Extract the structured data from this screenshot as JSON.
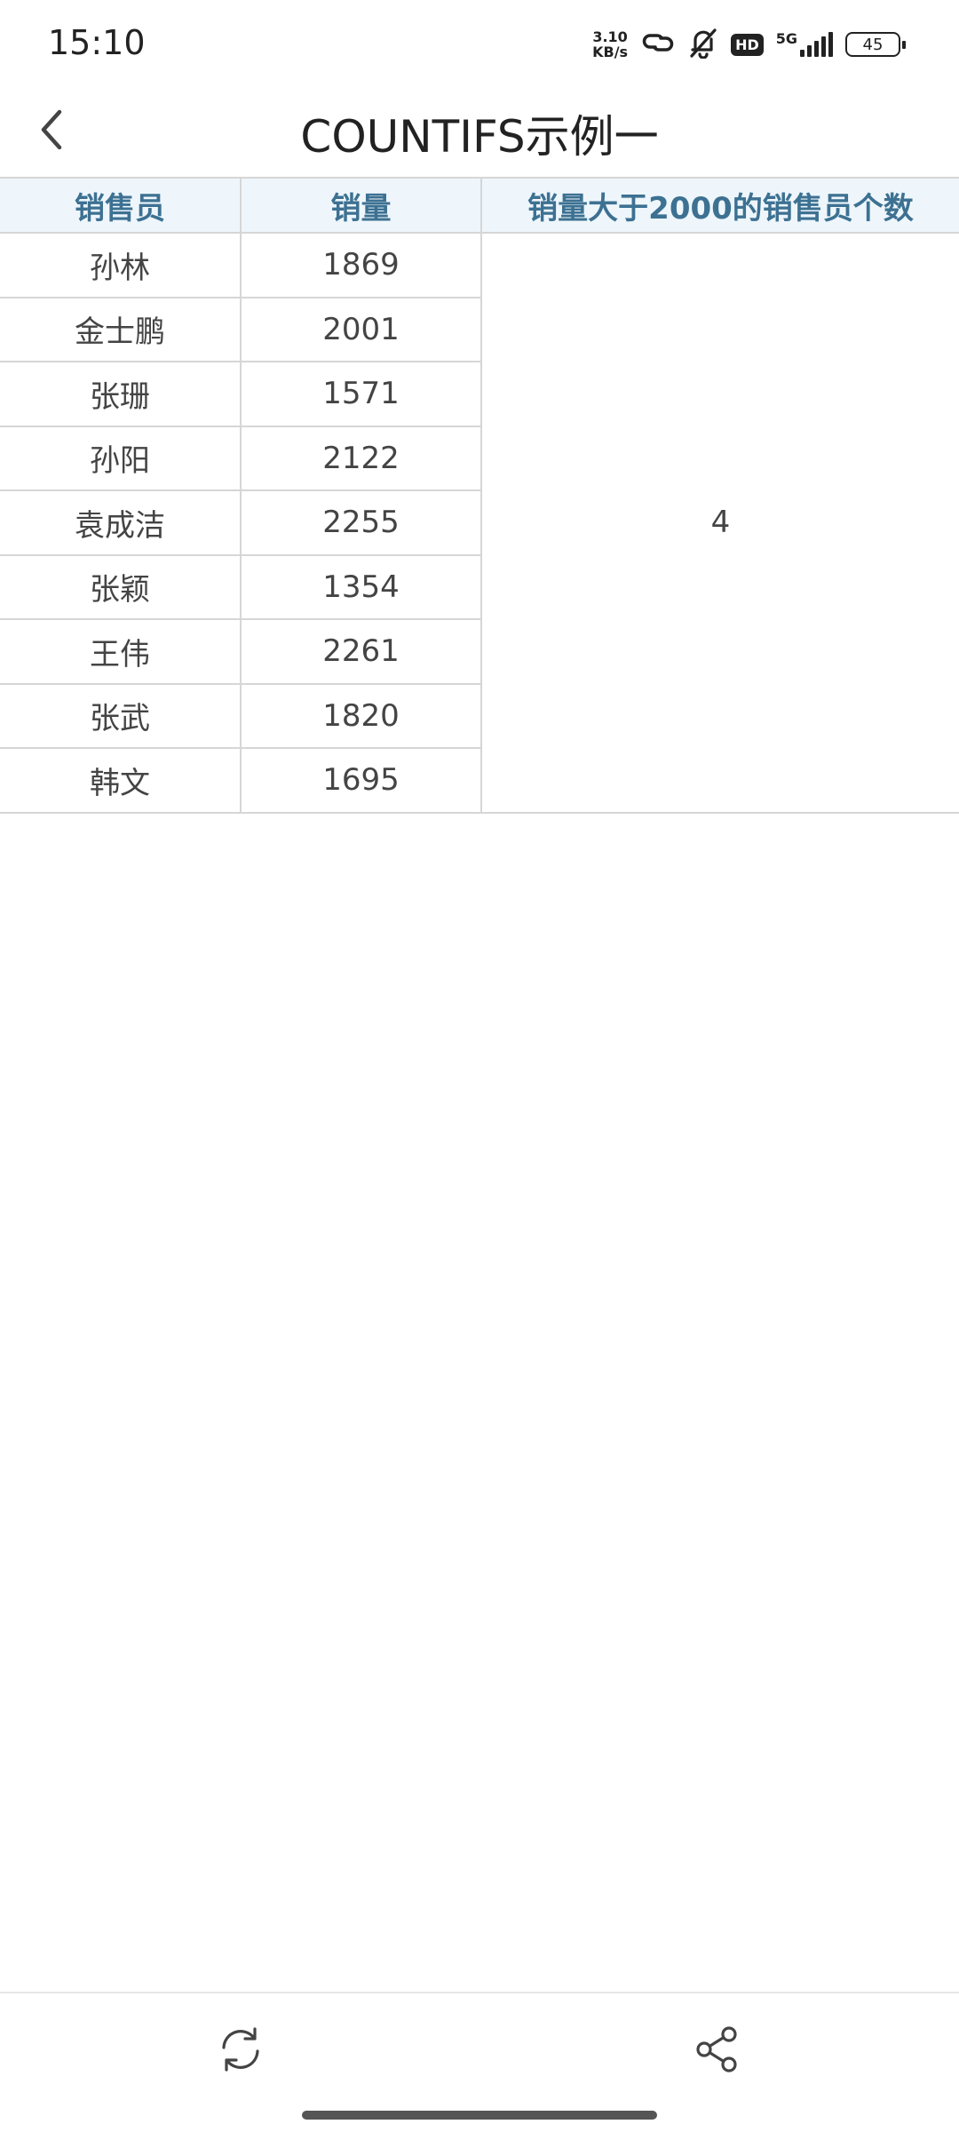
{
  "status_bar": {
    "time": "15:10",
    "net_speed_value": "3.10",
    "net_speed_unit": "KB/s",
    "hd": "HD",
    "network": "5G",
    "battery": "45",
    "icons": [
      "link-icon",
      "bell-off-icon",
      "signal-icon",
      "battery-icon"
    ]
  },
  "header": {
    "title": "COUNTIFS示例一",
    "back_icon": "chevron-left-icon"
  },
  "table": {
    "headers": [
      "销售员",
      "销量",
      "销量大于2000的销售员个数"
    ],
    "rows": [
      {
        "name": "孙林",
        "sales": "1869"
      },
      {
        "name": "金士鹏",
        "sales": "2001"
      },
      {
        "name": "张珊",
        "sales": "1571"
      },
      {
        "name": "孙阳",
        "sales": "2122"
      },
      {
        "name": "袁成洁",
        "sales": "2255"
      },
      {
        "name": "张颖",
        "sales": "1354"
      },
      {
        "name": "王伟",
        "sales": "2261"
      },
      {
        "name": "张武",
        "sales": "1820"
      },
      {
        "name": "韩文",
        "sales": "1695"
      }
    ],
    "result": "4"
  },
  "toolbar": {
    "icons": [
      "refresh-icon",
      "share-icon"
    ]
  }
}
